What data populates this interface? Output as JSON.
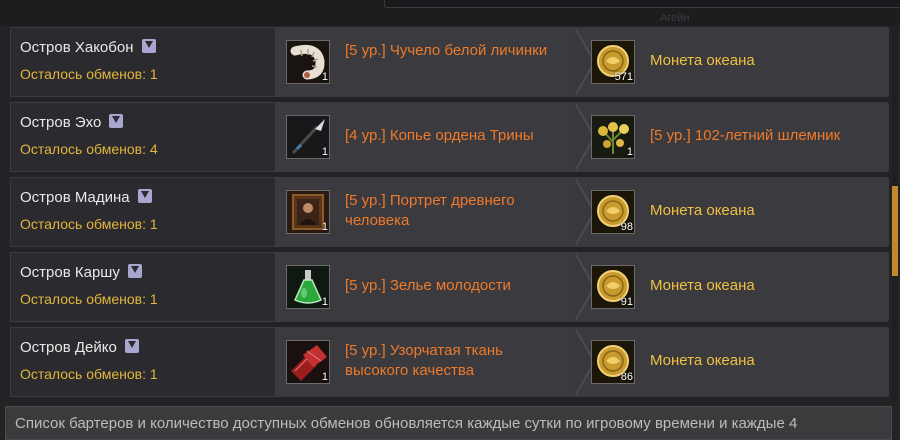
{
  "top_ghost": "Агейн",
  "rows": [
    {
      "island": "Остров Хакобон",
      "remaining": "Осталось обменов: 1",
      "give": {
        "label": "[5 ур.] Чучело белой личинки",
        "qty": "1",
        "icon": "larva-icon"
      },
      "get": {
        "label": "Монета океана",
        "qty": "571",
        "icon": "ocean-coin-icon",
        "color": "#f0c040"
      }
    },
    {
      "island": "Остров Эхо",
      "remaining": "Осталось обменов: 4",
      "give": {
        "label": "[4 ур.] Копье ордена Трины",
        "qty": "1",
        "icon": "spear-icon"
      },
      "get": {
        "label": "[5 ур.] 102-летний шлемник",
        "qty": "1",
        "icon": "skullcap-plant-icon",
        "color": "#ee7a2a"
      }
    },
    {
      "island": "Остров Мадина",
      "remaining": "Осталось обменов: 1",
      "give": {
        "label": "[5 ур.] Портрет древнего человека",
        "qty": "1",
        "icon": "portrait-icon"
      },
      "get": {
        "label": "Монета океана",
        "qty": "98",
        "icon": "ocean-coin-icon",
        "color": "#f0c040"
      }
    },
    {
      "island": "Остров Каршу",
      "remaining": "Осталось обменов: 1",
      "give": {
        "label": "[5 ур.] Зелье молодости",
        "qty": "1",
        "icon": "potion-icon"
      },
      "get": {
        "label": "Монета океана",
        "qty": "91",
        "icon": "ocean-coin-icon",
        "color": "#f0c040"
      }
    },
    {
      "island": "Остров Дейко",
      "remaining": "Осталось обменов: 1",
      "give": {
        "label": "[5 ур.] Узорчатая ткань высокого качества",
        "qty": "1",
        "icon": "fabric-icon"
      },
      "get": {
        "label": "Монета океана",
        "qty": "86",
        "icon": "ocean-coin-icon",
        "color": "#f0c040"
      }
    }
  ],
  "footer": {
    "text": "Список бартеров и количество доступных обменов обновляется каждые сутки по игровому времени и каждые 4"
  },
  "colors": {
    "accent_gold": "#f0c040",
    "accent_orange": "#ee7a2a",
    "remaining": "#e2b53c"
  }
}
